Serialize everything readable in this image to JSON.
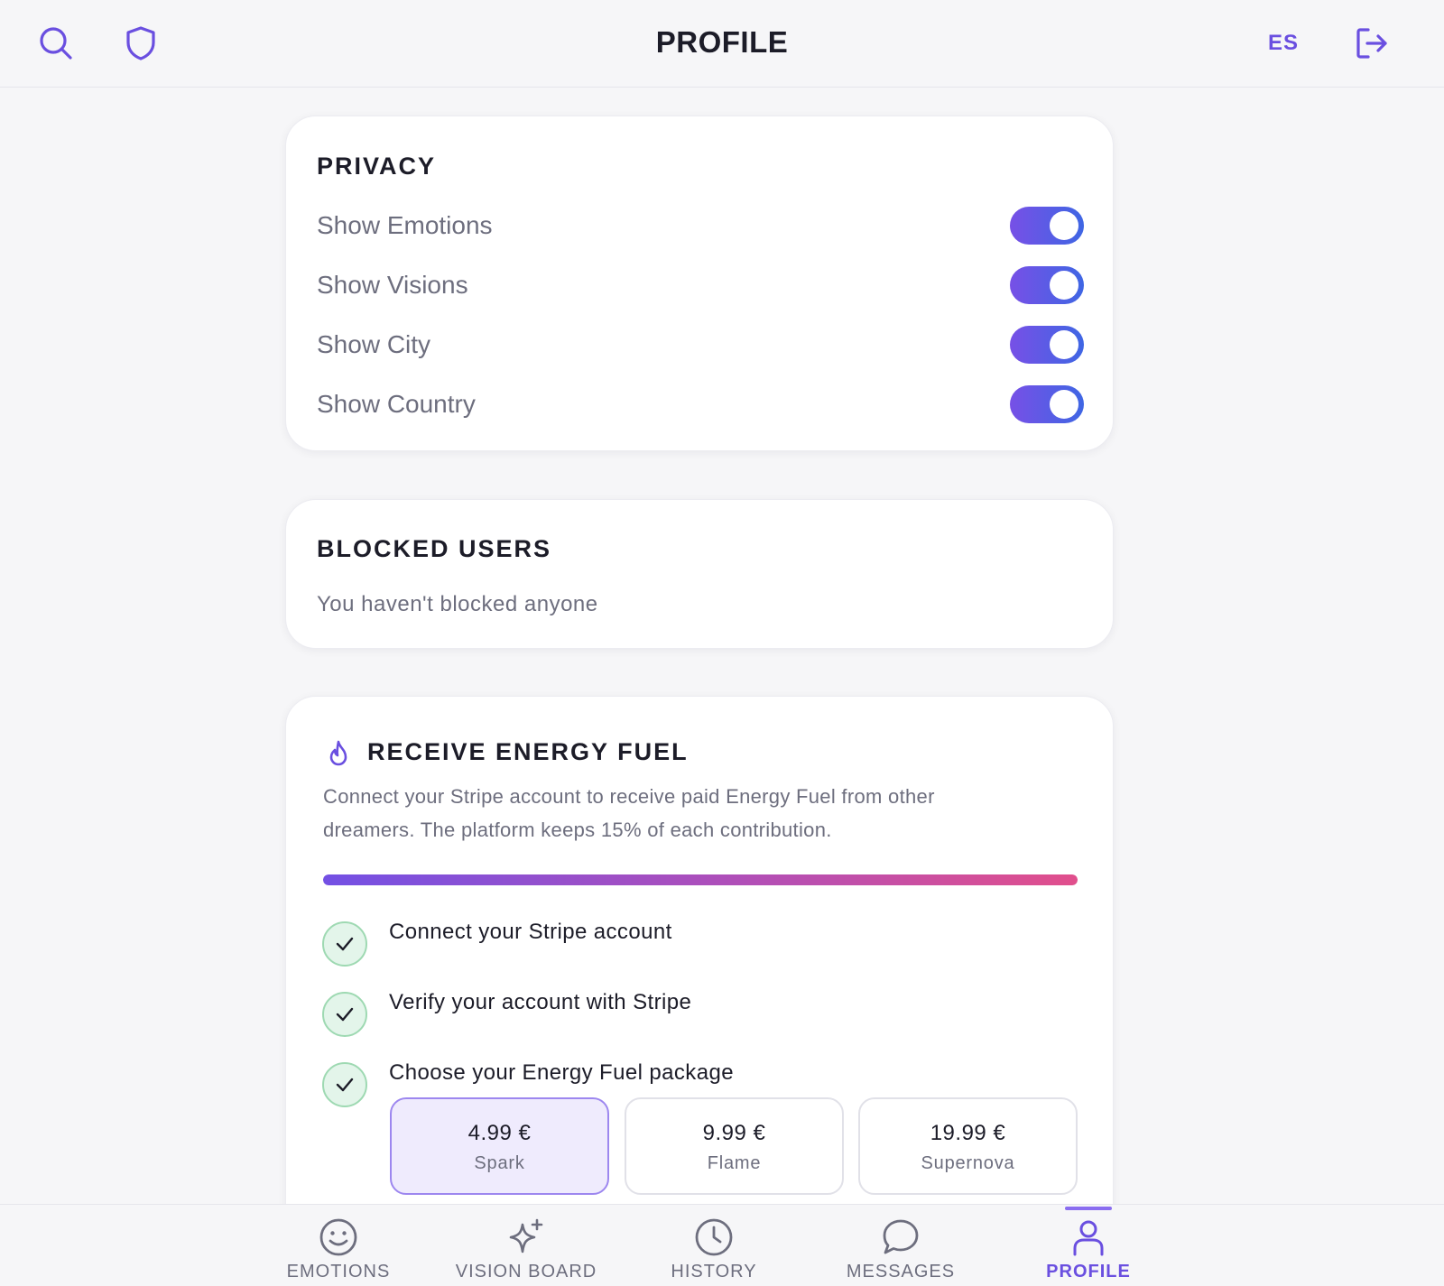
{
  "header": {
    "title": "PROFILE",
    "language": "ES",
    "left_icons": [
      "search-icon",
      "shield-icon"
    ],
    "right_icon": "logout-icon",
    "accent_color": "#6a4fe0"
  },
  "privacy": {
    "title": "PRIVACY",
    "toggles": [
      {
        "label": "Show Emotions",
        "on": true
      },
      {
        "label": "Show Visions",
        "on": true
      },
      {
        "label": "Show City",
        "on": true
      },
      {
        "label": "Show Country",
        "on": true
      }
    ]
  },
  "blocked_users": {
    "title": "BLOCKED USERS",
    "empty_text": "You haven't blocked anyone"
  },
  "energy_fuel": {
    "icon": "flame-icon",
    "title": "RECEIVE ENERGY FUEL",
    "description": "Connect your Stripe account to receive paid Energy Fuel from other dreamers. The platform keeps 15% of each contribution.",
    "progress": 1.0,
    "steps": [
      {
        "label": "Connect your Stripe account",
        "done": true
      },
      {
        "label": "Verify your account with Stripe",
        "done": true
      },
      {
        "label": "Choose your Energy Fuel package",
        "done": true
      }
    ],
    "packages": [
      {
        "price": "4.99 €",
        "name": "Spark",
        "selected": true
      },
      {
        "price": "9.99 €",
        "name": "Flame",
        "selected": false
      },
      {
        "price": "19.99 €",
        "name": "Supernova",
        "selected": false
      }
    ]
  },
  "bottom_nav": {
    "items": [
      {
        "label": "EMOTIONS",
        "icon": "smiley-icon",
        "active": false
      },
      {
        "label": "VISION BOARD",
        "icon": "sparkle-icon",
        "active": false
      },
      {
        "label": "HISTORY",
        "icon": "clock-icon",
        "active": false
      },
      {
        "label": "MESSAGES",
        "icon": "chat-bubble-icon",
        "active": false
      },
      {
        "label": "PROFILE",
        "icon": "user-icon",
        "active": true
      }
    ]
  }
}
